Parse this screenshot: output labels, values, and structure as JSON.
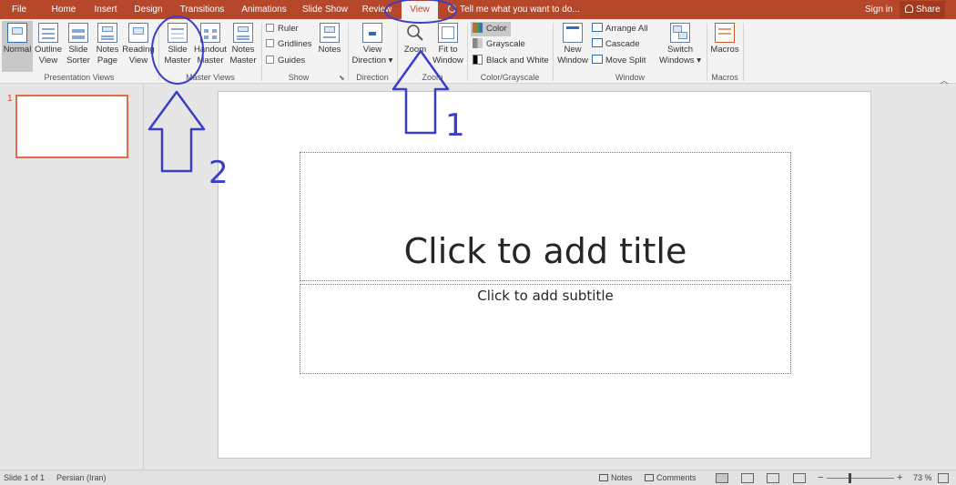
{
  "tabs": [
    {
      "label": "File"
    },
    {
      "label": "Home"
    },
    {
      "label": "Insert"
    },
    {
      "label": "Design"
    },
    {
      "label": "Transitions"
    },
    {
      "label": "Animations"
    },
    {
      "label": "Slide Show"
    },
    {
      "label": "Review"
    },
    {
      "label": "View"
    }
  ],
  "active_tab": "View",
  "tell_me": "Tell me what you want to do...",
  "sign_in": "Sign in",
  "share": "Share",
  "ribbon": {
    "presentation_views": {
      "label": "Presentation Views",
      "normal": "Normal",
      "outline": [
        "Outline",
        "View"
      ],
      "sorter": [
        "Slide",
        "Sorter"
      ],
      "notes_page": [
        "Notes",
        "Page"
      ],
      "reading": [
        "Reading",
        "View"
      ]
    },
    "master_views": {
      "label": "Master Views",
      "slide_master": [
        "Slide",
        "Master"
      ],
      "handout_master": [
        "Handout",
        "Master"
      ],
      "notes_master": [
        "Notes",
        "Master"
      ]
    },
    "show": {
      "label": "Show",
      "ruler": "Ruler",
      "gridlines": "Gridlines",
      "guides": "Guides",
      "notes": "Notes"
    },
    "direction": {
      "label": "Direction",
      "view_direction": [
        "View",
        "Direction ▾"
      ]
    },
    "zoom": {
      "label": "Zoom",
      "zoom": "Zoom",
      "fit": [
        "Fit to",
        "Window"
      ]
    },
    "color_grayscale": {
      "label": "Color/Grayscale",
      "color": "Color",
      "grayscale": "Grayscale",
      "black_white": "Black and White"
    },
    "window": {
      "label": "Window",
      "new_window": [
        "New",
        "Window"
      ],
      "arrange_all": "Arrange All",
      "cascade": "Cascade",
      "move_split": "Move Split",
      "switch": [
        "Switch",
        "Windows ▾"
      ]
    },
    "macros": {
      "label": "Macros",
      "macros": "Macros"
    }
  },
  "thumbnail_number": "1",
  "slide": {
    "title_placeholder": "Click to add title",
    "subtitle_placeholder": "Click to add subtitle"
  },
  "annotations": {
    "one": "1",
    "two": "2",
    "color": "#3b3fc8"
  },
  "status": {
    "slide": "Slide 1 of 1",
    "language": "Persian (Iran)",
    "notes": "Notes",
    "comments": "Comments",
    "zoom_minus": "−",
    "zoom_plus": "+",
    "zoom": "73 %"
  },
  "colors": {
    "accent": "#b7472a",
    "ribbon": "#f3f3f3",
    "workspace": "#e6e6e6"
  }
}
